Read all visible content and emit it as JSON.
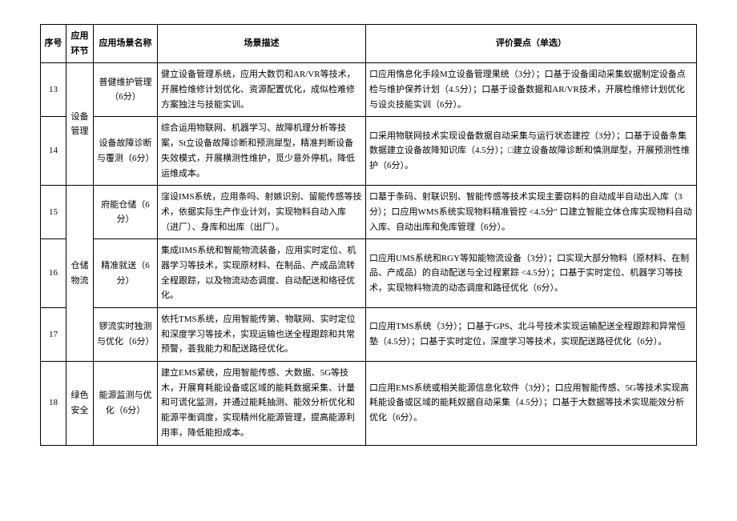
{
  "headers": {
    "seq": "序号",
    "branch": "应用环节",
    "name": "应用场景名称",
    "desc": "场景描述",
    "eval": "评价要点（单选）"
  },
  "branches": {
    "equip": "设备管理",
    "warehouse": "仓储物流",
    "green": "绿色安全"
  },
  "rows": [
    {
      "seq": "13",
      "name": "普健维护管理（6分）",
      "desc": "健立设备管理系统，应用大数罚和AR/VR等技术，开展检维修计划优化、资源配置优化，成似检难修方案独注与技能实训。",
      "eval": "口应用惰息化手段M立设备管理果统（3分）；口基于设备闺动采集蚁据制定设备点检与维护保养计划（4.5分）；口基于设备数据和AR/VR技术，开展检维修计划优化与设炎技能实训（6分）。"
    },
    {
      "seq": "14",
      "name": "设备故障诊断与覆测（6分）",
      "desc": "综合运用物联网、机器学习、故障机理分析等技案，St立设备故障诊断和预测犀型，精准判断设备失效模式，开展横测性维护，觅少意外停机，降低运维成本。",
      "eval": "口采用物联网技术实现设备数据自动采集与运行状态建控（3分）；口基于设备条集数据建立设备故降知识库（4.5分）；□建立设备故障诊断和慎测犀型，开展预测性维护（6分）。"
    },
    {
      "seq": "15",
      "name": "府能仓储（6分）",
      "desc": "窪设IMS系统，应用条吗、射嫉识别、留能传感等技术，依据实际生产作业计刘，实现物料自动入库（进厂）、身库和出库（出厂）。",
      "eval": "口墓于条码、射联识别、智能传感等技术实现主要窃料的自动成半自动出入库（3分）；口应用WMS系统实现物料精准管控 <4.5分\" 口建立智能立体仓库实现物料自动入库、自动出库和免库管理（6分）。"
    },
    {
      "seq": "16",
      "name": "精准就送（6分）",
      "desc": "集成IIMS系统和智能物流装备，应用实时定位、机器学习等技术，实现原材料、在制品、产成品流转全程跟踪，以及物流动态调度、自动配送和络径优化。",
      "eval": "口应用UMS系统和RGY等知能物流设备（3分）；口实现大部分物料（原材料、在制品、产成品）的自动配送与全过程累踪 <4.5分）；口基于实时定位、机器学习等技术，实现物料物流的动态调度和路径优化（6分）。"
    },
    {
      "seq": "17",
      "name": "锣流实时独测与优化（6分）",
      "desc": "依托TMS系统，应用智能传第、物联网、实时定位和深度学习等技术，实现运输也送全程跟踪和共常预警，荟我能力和配送路径优化。",
      "eval": "口应用TMS系统（3分）；口基于GPS、北斗号技术实现运输配送全程跟踪和异常恒塾（4.5分）；口基于实时定位，深度学习等技术，实现配送路径优化（6分）。"
    },
    {
      "seq": "18",
      "name": "能源监测与优化（6分）",
      "desc": "建立EMS紧统，应用智能传感、大数据、5G等技木，开展育耗能设备或区域的能耗数据采集、计量和可谎化监测，并通过能耗抽测、能效分析优化和能源平衡调度，实现精州化能源管理，提高能源利用率，降低能担成本。",
      "eval": "口应用EMS系统或相关能源信息化软件（3分）；口应用智能传感、5G等技术实现高耗能设备或区域的能耗奴据自动采集（4.5分）；口基于大数据等技术实现能效分析优化（6分）。"
    }
  ]
}
